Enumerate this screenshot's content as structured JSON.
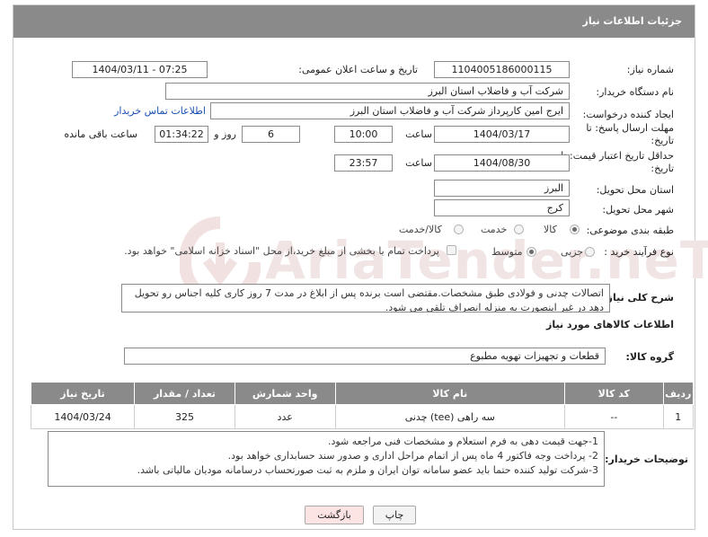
{
  "header": {
    "title": "جزئیات اطلاعات نیاز"
  },
  "watermark": {
    "text": "AriaTender.neT"
  },
  "form": {
    "need_number_label": "شماره نیاز:",
    "need_number": "1104005186000115",
    "announce_label": "تاریخ و ساعت اعلان عمومی:",
    "announce_value": "1404/03/11 - 07:25",
    "buyer_label": "نام دستگاه خریدار:",
    "buyer_value": "شرکت آب و فاضلاب استان البرز",
    "creator_label": "ایجاد کننده درخواست:",
    "creator_value": "ایرج امین کارپرداز شرکت آب و فاضلاب استان البرز",
    "contact_link": "اطلاعات تماس خریدار",
    "deadline_label": "مهلت ارسال پاسخ: تا تاریخ:",
    "deadline_date": "1404/03/17",
    "time_label": "ساعت",
    "deadline_time": "10:00",
    "days_value": "6",
    "days_label": "روز و",
    "remaining_time": "01:34:22",
    "remaining_label": "ساعت باقی مانده",
    "validity_label": "حداقل تاریخ اعتبار قیمت: تا تاریخ:",
    "validity_date": "1404/08/30",
    "validity_time": "23:57",
    "province_label": "استان محل تحویل:",
    "province_value": "البرز",
    "city_label": "شهر محل تحویل:",
    "city_value": "کرج",
    "category_label": "طبقه بندی موضوعی:",
    "category_options": [
      "کالا",
      "خدمت",
      "کالا/خدمت"
    ],
    "category_selected": "کالا",
    "process_label": "نوع فرآیند خرید :",
    "process_options": [
      "جزیی",
      "متوسط"
    ],
    "process_selected": "متوسط",
    "payment_note": "پرداخت تمام یا بخشی از مبلغ خرید،از محل \"اسناد خزانه اسلامی\" خواهد بود."
  },
  "description": {
    "label": "شرح کلی نیاز:",
    "text": "اتصالات چدنی و فولادی طبق مشخصات.مقتضی است برنده پس از ابلاغ در مدت 7 روز کاری کلیه اجناس رو تحویل دهد در غیر اینصورت به منزله انصراف تلقی می شود."
  },
  "goods": {
    "section_title": "اطلاعات کالاهای مورد نیاز",
    "group_label": "گروه کالا:",
    "group_value": "قطعات و تجهیزات تهویه مطبوع",
    "columns": [
      "ردیف",
      "کد کالا",
      "نام کالا",
      "واحد شمارش",
      "تعداد / مقدار",
      "تاریخ نیاز"
    ],
    "rows": [
      {
        "row": "1",
        "code": "--",
        "name": "سه راهی (tee) چدنی",
        "unit": "عدد",
        "qty": "325",
        "date": "1404/03/24"
      }
    ]
  },
  "buyer_notes": {
    "label": "توضیحات خریدار:",
    "lines": [
      "1-جهت قیمت دهی به فرم استعلام و مشخصات فنی مراجعه شود.",
      "2- پرداخت وجه فاکتور 4 ماه پس از اتمام مراحل اداری و صدور سند حسابداری خواهد بود.",
      "3-شرکت تولید کننده حتما باید عضو سامانه توان ایران و ملزم به ثبت صورتحساب درسامانه مودیان مالیاتی باشد."
    ]
  },
  "buttons": {
    "print": "چاپ",
    "back": "بازگشت"
  },
  "colors": {
    "header_bg": "#8a8a8a",
    "link": "#1a4fb5",
    "back_button_bg": "#fde4e4"
  }
}
